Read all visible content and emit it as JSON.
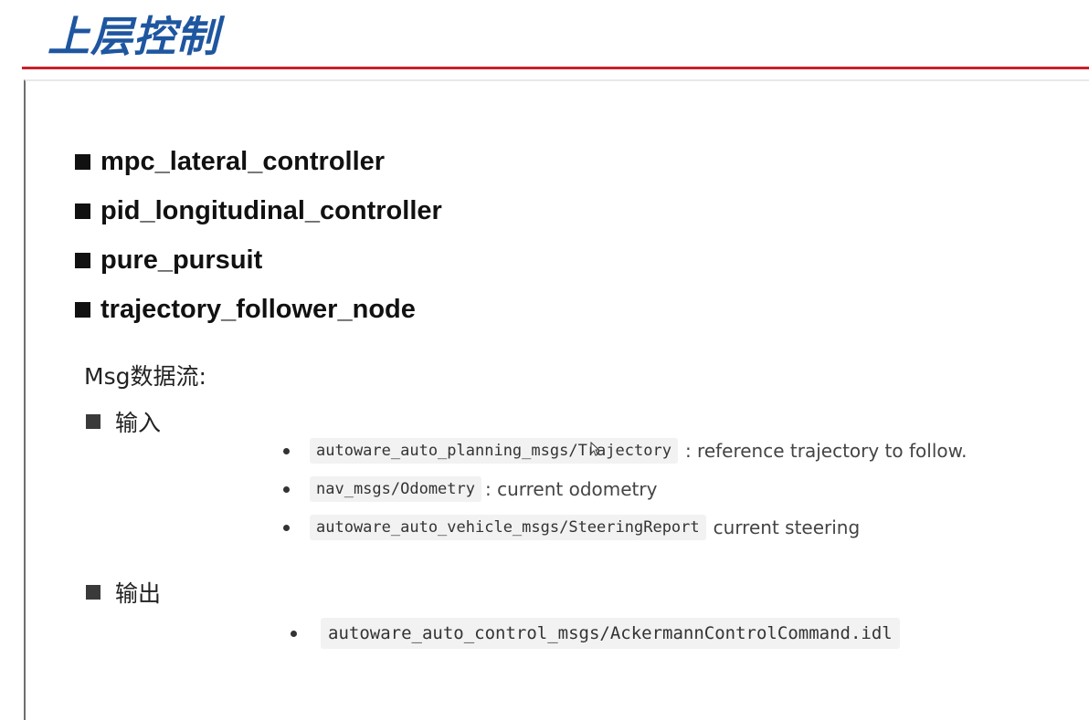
{
  "title": "上层控制",
  "modules": [
    "mpc_lateral_controller",
    "pid_longitudinal_controller",
    "pure_pursuit",
    "trajectory_follower_node"
  ],
  "msg_heading": "Msg数据流:",
  "input": {
    "label": "输入",
    "items": [
      {
        "code": "autoware_auto_planning_msgs/Trajectory",
        "desc": ": reference trajectory to follow."
      },
      {
        "code": "nav_msgs/Odometry",
        "desc": ": current odometry"
      },
      {
        "code": "autoware_auto_vehicle_msgs/SteeringReport",
        "desc": "current steering"
      }
    ]
  },
  "output": {
    "label": "输出",
    "items": [
      {
        "code": "autoware_auto_control_msgs/AckermannControlCommand.idl"
      }
    ]
  }
}
